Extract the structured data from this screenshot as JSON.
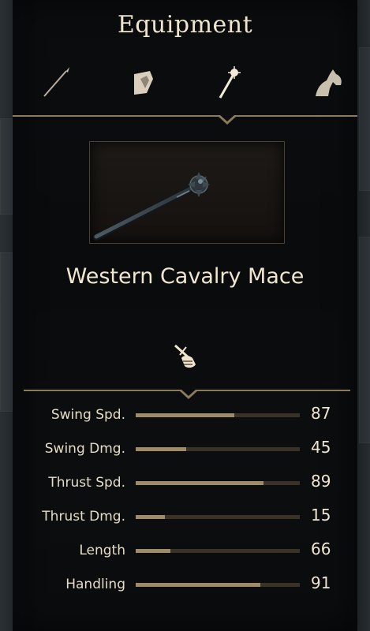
{
  "panel": {
    "title": "Equipment",
    "tabs": [
      {
        "icon": "spear-icon",
        "active": false
      },
      {
        "icon": "shield-icon",
        "active": false
      },
      {
        "icon": "mace-icon",
        "active": true
      },
      {
        "icon": "horse-icon",
        "active": false
      }
    ]
  },
  "item": {
    "name": "Western Cavalry Mace",
    "preview_icon": "mace-icon",
    "usage_icon": "one-handed-weapon-icon"
  },
  "stats": [
    {
      "label": "Swing Spd.",
      "value": "87",
      "fill": 0.6
    },
    {
      "label": "Swing Dmg.",
      "value": "45",
      "fill": 0.31
    },
    {
      "label": "Thrust Spd.",
      "value": "89",
      "fill": 0.78
    },
    {
      "label": "Thrust Dmg.",
      "value": "15",
      "fill": 0.18
    },
    {
      "label": "Length",
      "value": "66",
      "fill": 0.21
    },
    {
      "label": "Handling",
      "value": "91",
      "fill": 0.76
    }
  ],
  "colors": {
    "accent": "#8c7a5c",
    "bar_fill": "#a08b68",
    "bar_track": "#3b3227",
    "text": "#efe4cc"
  }
}
